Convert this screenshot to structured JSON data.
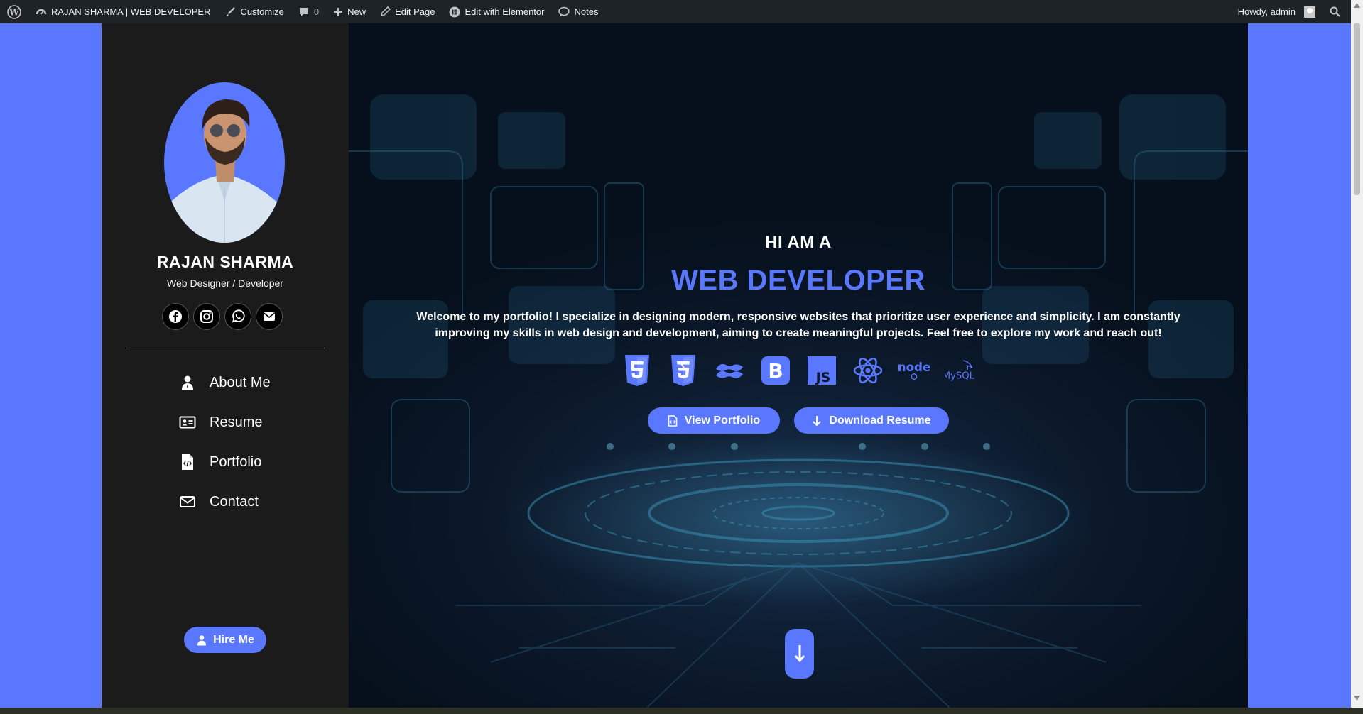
{
  "admin_bar": {
    "site_name": "RAJAN SHARMA | WEB DEVELOPER",
    "customize": "Customize",
    "comments_count": "0",
    "new": "New",
    "edit_page": "Edit Page",
    "edit_elementor": "Edit with Elementor",
    "notes": "Notes",
    "howdy": "Howdy, admin"
  },
  "sidebar": {
    "name": "RAJAN SHARMA",
    "role": "Web Designer / Developer",
    "socials": [
      "facebook-icon",
      "instagram-icon",
      "whatsapp-icon",
      "email-icon"
    ],
    "nav": [
      {
        "label": "About Me",
        "icon": "user-icon"
      },
      {
        "label": "Resume",
        "icon": "id-card-icon"
      },
      {
        "label": "Portfolio",
        "icon": "code-file-icon"
      },
      {
        "label": "Contact",
        "icon": "envelope-icon"
      }
    ],
    "hire_label": "Hire Me"
  },
  "hero": {
    "hi": "HI AM A",
    "title": "WEB DEVELOPER",
    "intro": "Welcome to my portfolio! I specialize in designing modern, responsive websites that prioritize user experience and simplicity. I am constantly improving my skills in web design and development, aiming to create meaningful projects. Feel free to explore my work and reach out!",
    "techs": [
      {
        "icon": "html5-icon"
      },
      {
        "icon": "css3-icon"
      },
      {
        "icon": "tailwind-icon"
      },
      {
        "icon": "bootstrap-icon",
        "text": "B"
      },
      {
        "icon": "javascript-icon",
        "text": "JS"
      },
      {
        "icon": "react-icon"
      },
      {
        "icon": "nodejs-icon",
        "text": "node"
      },
      {
        "icon": "mysql-icon",
        "text": "MySQL"
      }
    ],
    "view_portfolio": "View Portfolio",
    "download_resume": "Download Resume"
  },
  "colors": {
    "accent": "#5a78ff",
    "admin_bar": "#1d2327",
    "sidebar": "#1b1b1b",
    "hero_bg": "#091424"
  }
}
